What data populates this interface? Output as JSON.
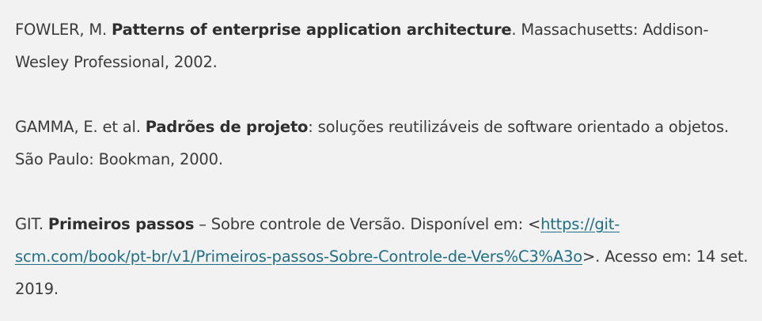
{
  "references": [
    {
      "author": "FOWLER, M. ",
      "title": "Patterns of enterprise application architecture",
      "rest": ". Massachusetts: Addison-Wesley Professional, 2002."
    },
    {
      "author": "GAMMA, E. et al. ",
      "title": "Padrões de projeto",
      "rest": ": soluções reutilizáveis de software orientado a objetos. São Paulo: Bookman, 2000."
    },
    {
      "author": "GIT. ",
      "title": "Primeiros passos",
      "rest": " – Sobre controle de Versão. Disponível em: <",
      "link": "https://git-scm.com/book/pt-br/v1/Primeiros-passos-Sobre-Controle-de-Vers%C3%A3o",
      "after": ">. Acesso em: 14 set. 2019."
    }
  ]
}
